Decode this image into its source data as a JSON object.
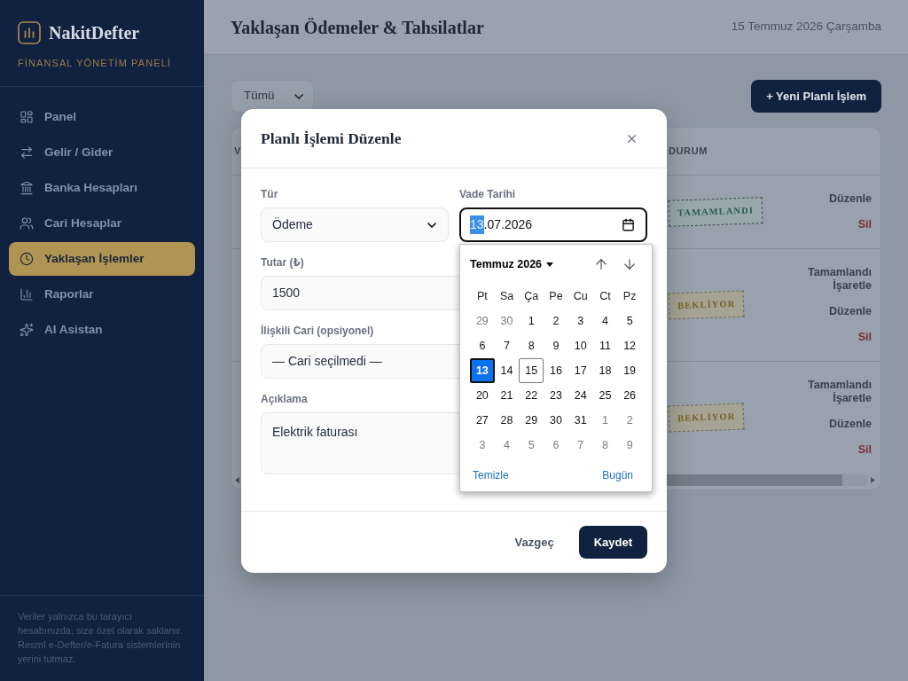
{
  "sidebar": {
    "brand": "NakitDefter",
    "tagline": "FİNANSAL YÖNETİM PANELİ",
    "items": [
      {
        "label": "Panel",
        "selected": false
      },
      {
        "label": "Gelir / Gider",
        "selected": false
      },
      {
        "label": "Banka Hesapları",
        "selected": false
      },
      {
        "label": "Cari Hesaplar",
        "selected": false
      },
      {
        "label": "Yaklaşan İşlemler",
        "selected": true
      },
      {
        "label": "Raporlar",
        "selected": false
      },
      {
        "label": "AI Asistan",
        "selected": false
      }
    ],
    "footer_note": "Veriler yalnızca bu tarayıcı hesabınızda, size özel olarak saklanır. Resmî e-Defter/e-Fatura sistemlerinin yerini tutmaz."
  },
  "header": {
    "title": "Yaklaşan Ödemeler & Tahsilatlar",
    "date": "15 Temmuz 2026 Çarşamba"
  },
  "toolbar": {
    "filter_value": "Tümü",
    "new_button": "+ Yeni Planlı İşlem"
  },
  "table": {
    "columns": [
      {
        "lines": [
          "V"
        ]
      },
      {
        "lines": [
          "DURUM"
        ]
      }
    ],
    "rows": [
      {
        "status": {
          "label": "TAMAMLANDI",
          "kind": "done"
        },
        "actions": [
          {
            "label": "Düzenle",
            "kind": "edit"
          },
          {
            "label": "Sil",
            "kind": "delete"
          }
        ]
      },
      {
        "status": {
          "label": "BEKLİYOR",
          "kind": "pending"
        },
        "actions": [
          {
            "label": "Tamamlandı İşaretle",
            "kind": "complete"
          },
          {
            "label": "Düzenle",
            "kind": "edit"
          },
          {
            "label": "Sil",
            "kind": "delete"
          }
        ]
      },
      {
        "status": {
          "label": "BEKLİYOR",
          "kind": "pending"
        },
        "actions": [
          {
            "label": "Tamamlandı İşaretle",
            "kind": "complete"
          },
          {
            "label": "Düzenle",
            "kind": "edit"
          },
          {
            "label": "Sil",
            "kind": "delete"
          }
        ]
      }
    ]
  },
  "dialog": {
    "title": "Planlı İşlemi Düzenle",
    "fields": [
      {
        "label": "Tür",
        "kind": "select",
        "value": "Ödeme"
      },
      {
        "label": "Vade Tarihi",
        "kind": "date",
        "focused": true,
        "segments": [
          {
            "text": "13",
            "selected": true
          },
          {
            "text": ".07.2026",
            "selected": false
          }
        ]
      },
      {
        "label": "Tutar (₺)",
        "kind": "text",
        "value": "1500"
      },
      {
        "label": "İlişkili Cari (opsiyonel)",
        "kind": "select",
        "value": "— Cari seçilmedi —"
      },
      {
        "label": "Açıklama",
        "kind": "textarea",
        "value": "Elektrik faturası"
      }
    ],
    "date_picker": {
      "month": "Temmuz 2026",
      "weekdays": [
        "Pt",
        "Sa",
        "Ça",
        "Pe",
        "Cu",
        "Ct",
        "Pz"
      ],
      "weeks": [
        [
          {
            "day": "29",
            "outside": true,
            "selected": false,
            "today": false
          },
          {
            "day": "30",
            "outside": true,
            "selected": false,
            "today": false
          },
          {
            "day": "1",
            "outside": false,
            "selected": false,
            "today": false
          },
          {
            "day": "2",
            "outside": false,
            "selected": false,
            "today": false
          },
          {
            "day": "3",
            "outside": false,
            "selected": false,
            "today": false
          },
          {
            "day": "4",
            "outside": false,
            "selected": false,
            "today": false
          },
          {
            "day": "5",
            "outside": false,
            "selected": false,
            "today": false
          }
        ],
        [
          {
            "day": "6",
            "outside": false,
            "selected": false,
            "today": false
          },
          {
            "day": "7",
            "outside": false,
            "selected": false,
            "today": false
          },
          {
            "day": "8",
            "outside": false,
            "selected": false,
            "today": false
          },
          {
            "day": "9",
            "outside": false,
            "selected": false,
            "today": false
          },
          {
            "day": "10",
            "outside": false,
            "selected": false,
            "today": false
          },
          {
            "day": "11",
            "outside": false,
            "selected": false,
            "today": false
          },
          {
            "day": "12",
            "outside": false,
            "selected": false,
            "today": false
          }
        ],
        [
          {
            "day": "13",
            "outside": false,
            "selected": true,
            "today": false
          },
          {
            "day": "14",
            "outside": false,
            "selected": false,
            "today": false
          },
          {
            "day": "15",
            "outside": false,
            "selected": false,
            "today": true
          },
          {
            "day": "16",
            "outside": false,
            "selected": false,
            "today": false
          },
          {
            "day": "17",
            "outside": false,
            "selected": false,
            "today": false
          },
          {
            "day": "18",
            "outside": false,
            "selected": false,
            "today": false
          },
          {
            "day": "19",
            "outside": false,
            "selected": false,
            "today": false
          }
        ],
        [
          {
            "day": "20",
            "outside": false,
            "selected": false,
            "today": false
          },
          {
            "day": "21",
            "outside": false,
            "selected": false,
            "today": false
          },
          {
            "day": "22",
            "outside": false,
            "selected": false,
            "today": false
          },
          {
            "day": "23",
            "outside": false,
            "selected": false,
            "today": false
          },
          {
            "day": "24",
            "outside": false,
            "selected": false,
            "today": false
          },
          {
            "day": "25",
            "outside": false,
            "selected": false,
            "today": false
          },
          {
            "day": "26",
            "outside": false,
            "selected": false,
            "today": false
          }
        ],
        [
          {
            "day": "27",
            "outside": false,
            "selected": false,
            "today": false
          },
          {
            "day": "28",
            "outside": false,
            "selected": false,
            "today": false
          },
          {
            "day": "29",
            "outside": false,
            "selected": false,
            "today": false
          },
          {
            "day": "30",
            "outside": false,
            "selected": false,
            "today": false
          },
          {
            "day": "31",
            "outside": false,
            "selected": false,
            "today": false
          },
          {
            "day": "1",
            "outside": true,
            "selected": false,
            "today": false
          },
          {
            "day": "2",
            "outside": true,
            "selected": false,
            "today": false
          }
        ],
        [
          {
            "day": "3",
            "outside": true,
            "selected": false,
            "today": false
          },
          {
            "day": "4",
            "outside": true,
            "selected": false,
            "today": false
          },
          {
            "day": "5",
            "outside": true,
            "selected": false,
            "today": false
          },
          {
            "day": "6",
            "outside": true,
            "selected": false,
            "today": false
          },
          {
            "day": "7",
            "outside": true,
            "selected": false,
            "today": false
          },
          {
            "day": "8",
            "outside": true,
            "selected": false,
            "today": false
          },
          {
            "day": "9",
            "outside": true,
            "selected": false,
            "today": false
          }
        ]
      ],
      "clear": "Temizle",
      "today": "Bugün"
    },
    "buttons": [
      {
        "label": "Vazgeç",
        "kind": "secondary"
      },
      {
        "label": "Kaydet",
        "kind": "primary"
      }
    ]
  }
}
